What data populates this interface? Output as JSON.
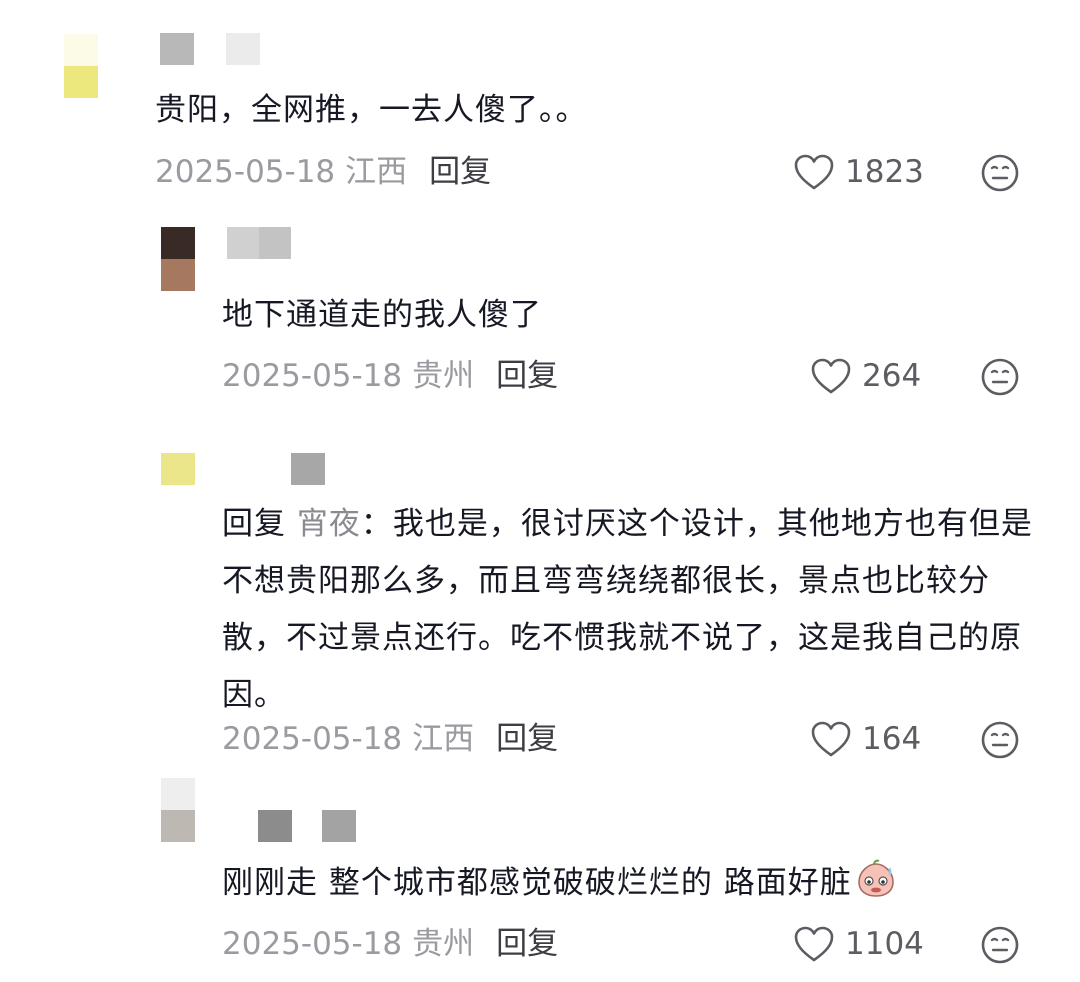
{
  "comments": [
    {
      "text": "贵阳，全网推，一去人傻了。。",
      "date": "2025-05-18",
      "location": "江西",
      "reply_label": "回复",
      "likes": "1823"
    },
    {
      "text": "地下通道走的我人傻了",
      "date": "2025-05-18",
      "location": "贵州",
      "reply_label": "回复",
      "likes": "264"
    },
    {
      "reply_prefix": "回复",
      "reply_to": "宵夜",
      "separator": "：",
      "text": "我也是，很讨厌这个设计，其他地方也有但是不想贵阳那么多，而且弯弯绕绕都很长，景点也比较分散，不过景点还行。吃不惯我就不说了，这是我自己的原因。",
      "date": "2025-05-18",
      "location": "江西",
      "reply_label": "回复",
      "likes": "164"
    },
    {
      "text": "刚刚走 整个城市都感觉破破烂烂的 路面好脏",
      "date": "2025-05-18",
      "location": "贵州",
      "reply_label": "回复",
      "likes": "1104"
    }
  ],
  "icons": {
    "like": "heart-outline-icon",
    "dislike": "meh-face-icon",
    "emoji": "sweat-peach-face-icon"
  }
}
